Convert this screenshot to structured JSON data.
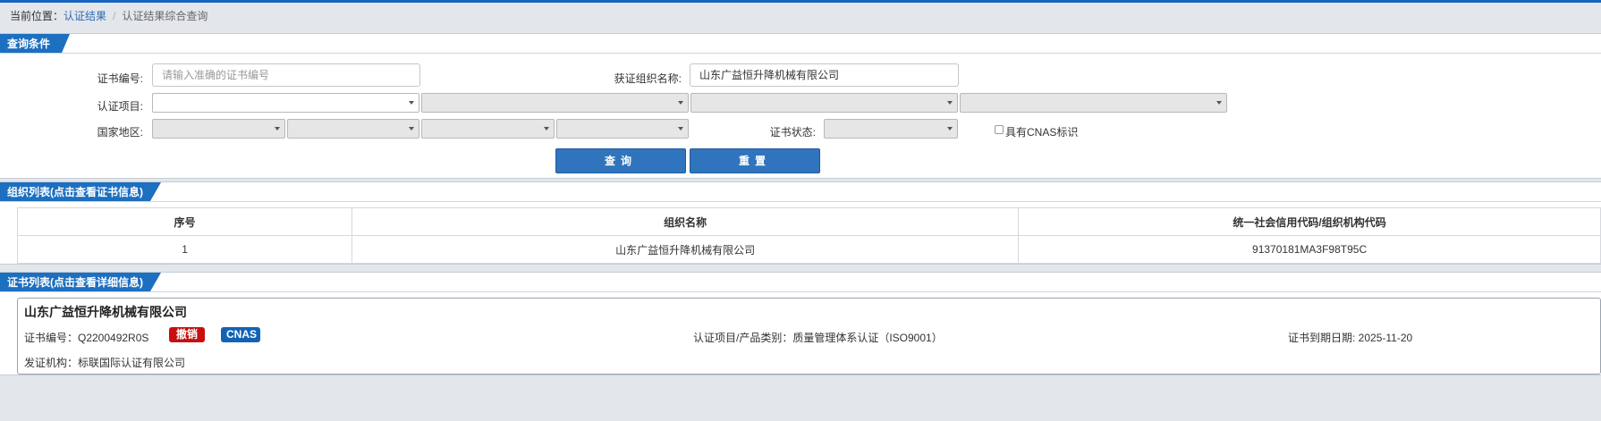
{
  "breadcrumb": {
    "prefix": "当前位置：",
    "link": "认证结果",
    "sep": "/",
    "current": "认证结果综合查询"
  },
  "query_panel": {
    "tab": "查询条件",
    "cert_no_label": "证书编号:",
    "cert_no_placeholder": "请输入准确的证书编号",
    "org_name_label": "获证组织名称:",
    "org_name_value": "山东广益恒升降机械有限公司",
    "cert_project_label": "认证项目:",
    "region_label": "国家地区:",
    "cert_status_label": "证书状态:",
    "cnas_label": "具有CNAS标识",
    "search_button": "查询",
    "reset_button": "重置"
  },
  "org_list": {
    "tab": "组织列表(点击查看证书信息)",
    "headers": [
      "序号",
      "组织名称",
      "统一社会信用代码/组织机构代码"
    ],
    "rows": [
      {
        "no": "1",
        "name": "山东广益恒升降机械有限公司",
        "code": "91370181MA3F98T95C"
      }
    ]
  },
  "cert_list": {
    "tab": "证书列表(点击查看详细信息)",
    "card": {
      "org": "山东广益恒升降机械有限公司",
      "cert_no": "证书编号：Q2200492R0S",
      "status_badge": "撤销",
      "cnas_badge": "CNAS",
      "project": "认证项目/产品类别：质量管理体系认证（ISO9001）",
      "expiry": "证书到期日期: 2025-11-20",
      "issuer": "发证机构：标联国际认证有限公司"
    }
  },
  "colors": {
    "accent": "#1d6fc0",
    "revoked": "#c80e0e",
    "cnas": "#1363b5"
  }
}
